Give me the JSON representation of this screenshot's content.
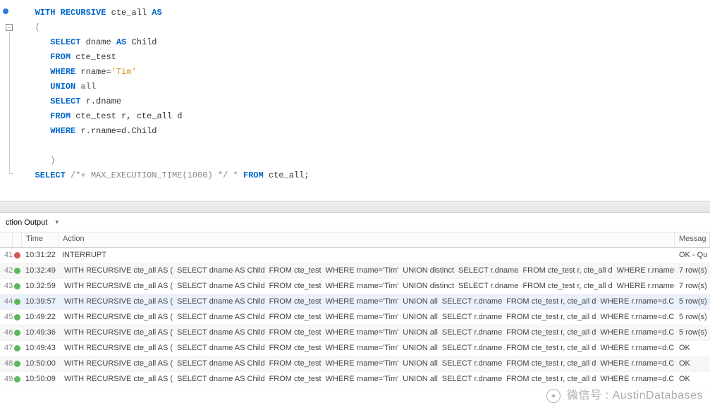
{
  "editor": {
    "lines": [
      {
        "indent": 1,
        "tokens": [
          {
            "cls": "kw",
            "t": "WITH RECURSIVE"
          },
          {
            "cls": "id",
            "t": " cte_all "
          },
          {
            "cls": "kw",
            "t": "AS"
          }
        ]
      },
      {
        "indent": 1,
        "tokens": [
          {
            "cls": "op",
            "t": "("
          }
        ]
      },
      {
        "indent": 2,
        "tokens": [
          {
            "cls": "kw",
            "t": "SELECT"
          },
          {
            "cls": "id",
            "t": " dname "
          },
          {
            "cls": "kw",
            "t": "AS"
          },
          {
            "cls": "id",
            "t": " Child "
          }
        ]
      },
      {
        "indent": 2,
        "tokens": [
          {
            "cls": "kw",
            "t": "FROM"
          },
          {
            "cls": "id",
            "t": " cte_test"
          }
        ]
      },
      {
        "indent": 2,
        "tokens": [
          {
            "cls": "kw",
            "t": "WHERE"
          },
          {
            "cls": "id",
            "t": " rname="
          },
          {
            "cls": "str",
            "t": "'Tim'"
          }
        ]
      },
      {
        "indent": 2,
        "tokens": [
          {
            "cls": "kw",
            "t": "UNION"
          },
          {
            "cls": "kwg",
            "t": " all"
          }
        ]
      },
      {
        "indent": 2,
        "tokens": [
          {
            "cls": "kw",
            "t": "SELECT"
          },
          {
            "cls": "id",
            "t": " r.dname"
          }
        ]
      },
      {
        "indent": 2,
        "tokens": [
          {
            "cls": "kw",
            "t": "FROM"
          },
          {
            "cls": "id",
            "t": " cte_test r, cte_all d"
          }
        ]
      },
      {
        "indent": 2,
        "tokens": [
          {
            "cls": "kw",
            "t": "WHERE"
          },
          {
            "cls": "id",
            "t": " r.rname=d.Child"
          }
        ]
      },
      {
        "indent": 0,
        "tokens": []
      },
      {
        "indent": 2,
        "tokens": [
          {
            "cls": "op",
            "t": ")"
          }
        ]
      },
      {
        "indent": 1,
        "tokens": [
          {
            "cls": "kw",
            "t": "SELECT"
          },
          {
            "cls": "id",
            "t": " "
          },
          {
            "cls": "cmt",
            "t": "/*+ MAX_EXECUTION_TIME(1000) */"
          },
          {
            "cls": "id",
            "t": " "
          },
          {
            "cls": "op",
            "t": "*"
          },
          {
            "cls": "id",
            "t": " "
          },
          {
            "cls": "kw",
            "t": "FROM"
          },
          {
            "cls": "id",
            "t": " cte_all;"
          }
        ]
      }
    ]
  },
  "output": {
    "dropdown_label": "ction Output",
    "header": {
      "time": "Time",
      "action": "Action",
      "message": "Messag"
    },
    "rows": [
      {
        "idx": "41",
        "status": "err",
        "time": "10:31:22",
        "action_plain": "INTERRUPT",
        "msg": "OK - Qu"
      },
      {
        "idx": "42",
        "status": "ok",
        "time": "10:32:49",
        "segments": [
          "WITH RECURSIVE cte_all AS (",
          "SELECT dname AS Child",
          "FROM cte_test",
          "WHERE rname='Tim'",
          "UNION distinct",
          "SELECT r.dname",
          "FROM cte_test r, cte_all d",
          "WHERE r.rname=d...."
        ],
        "msg": "7 row(s)"
      },
      {
        "idx": "43",
        "status": "ok",
        "time": "10:32:59",
        "segments": [
          "WITH RECURSIVE cte_all AS (",
          "SELECT dname AS Child",
          "FROM cte_test",
          "WHERE rname='Tim'",
          "UNION distinct",
          "SELECT r.dname",
          "FROM cte_test r, cte_all d",
          "WHERE r.rname=d...."
        ],
        "msg": "7 row(s)"
      },
      {
        "idx": "44",
        "status": "ok",
        "time": "10:39:57",
        "selected": true,
        "segments": [
          "WITH RECURSIVE cte_all AS (",
          "SELECT dname AS Child",
          "FROM cte_test",
          "WHERE rname='Tim'",
          "UNION all",
          "SELECT r.dname",
          "FROM cte_test r, cte_all d",
          "WHERE r.rname=d.Child ..."
        ],
        "msg": "5 row(s)"
      },
      {
        "idx": "45",
        "status": "ok",
        "time": "10:49:22",
        "segments": [
          "WITH RECURSIVE cte_all AS (",
          "SELECT dname AS Child",
          "FROM cte_test",
          "WHERE rname='Tim'",
          "UNION all",
          "SELECT r.dname",
          "FROM cte_test r, cte_all d",
          "WHERE r.rname=d.Child ..."
        ],
        "msg": "5 row(s)"
      },
      {
        "idx": "46",
        "status": "ok",
        "time": "10:49:36",
        "segments": [
          "WITH RECURSIVE cte_all AS (",
          "SELECT dname AS Child",
          "FROM cte_test",
          "WHERE rname='Tim'",
          "UNION all",
          "SELECT r.dname",
          "FROM cte_test r, cte_all d",
          "WHERE r.rname=d.Child ..."
        ],
        "msg": "5 row(s)"
      },
      {
        "idx": "47",
        "status": "ok",
        "time": "10:49:43",
        "segments": [
          "WITH RECURSIVE cte_all AS (",
          "SELECT dname AS Child",
          "FROM cte_test",
          "WHERE rname='Tim'",
          "UNION all",
          "SELECT r.dname",
          "FROM cte_test r, cte_all d",
          "WHERE r.rname=d.Child ..."
        ],
        "msg": "OK"
      },
      {
        "idx": "48",
        "status": "ok",
        "time": "10:50:00",
        "segments": [
          "WITH RECURSIVE cte_all AS (",
          "SELECT dname AS Child",
          "FROM cte_test",
          "WHERE rname='Tim'",
          "UNION all",
          "SELECT r.dname",
          "FROM cte_test r, cte_all d",
          "WHERE r.rname=d.Child ..."
        ],
        "msg": "OK"
      },
      {
        "idx": "49",
        "status": "ok",
        "time": "10:50:09",
        "segments": [
          "WITH RECURSIVE cte_all AS (",
          "SELECT dname AS Child",
          "FROM cte_test",
          "WHERE rname='Tim'",
          "UNION all",
          "SELECT r.dname",
          "FROM cte_test r, cte_all d",
          "WHERE r.rname=d.Child ..."
        ],
        "msg": "OK"
      }
    ]
  },
  "watermark": {
    "prefix": "微信号 :",
    "name": "AustinDatabases"
  }
}
